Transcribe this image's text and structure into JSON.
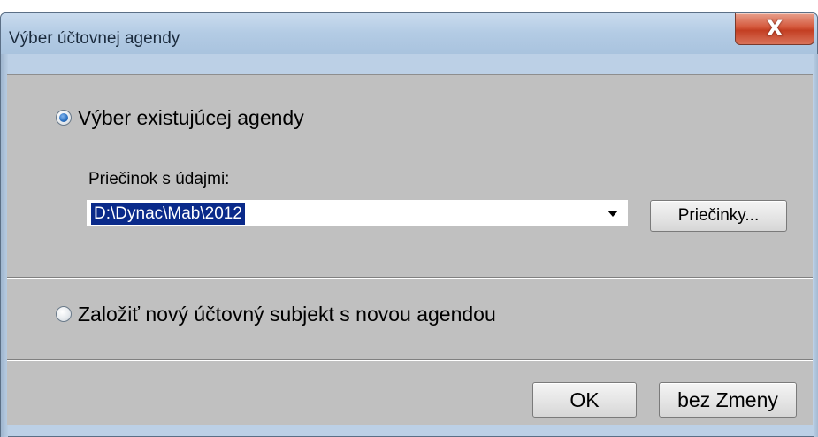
{
  "window": {
    "title": "Výber účtovnej agendy",
    "close_glyph": "X"
  },
  "options": {
    "existing_label": "Výber existujúcej agendy",
    "existing_checked": true,
    "new_label": "Založiť nový účtovný subjekt s novou agendou",
    "new_checked": false
  },
  "folder": {
    "label": "Priečinok s údajmi:",
    "value": "D:\\Dynac\\Mab\\2012",
    "browse_button": "Priečinky..."
  },
  "footer": {
    "ok_label": "OK",
    "cancel_label": "bez Zmeny"
  },
  "colors": {
    "title_bar": "#b3cbe4",
    "close_button": "#c33e22",
    "client": "#c0c0c0",
    "selection": "#0a2a8a",
    "radio_checked": "#2a6fc0"
  }
}
